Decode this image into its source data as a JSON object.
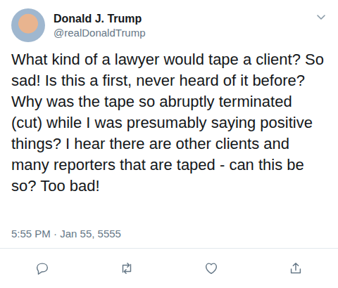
{
  "tweet": {
    "author": {
      "name": "Donald J. Trump",
      "handle": "@realDonaldTrump"
    },
    "text": "What kind of a lawyer would tape a client? So sad! Is this a first, never heard of it before? Why was the tape so abruptly terminated (cut) while I was presumably saying positive things? I hear there are other clients and many reporters that are taped - can this be so? Too bad!",
    "timestamp": "5:55 PM · Jan 55, 5555"
  }
}
